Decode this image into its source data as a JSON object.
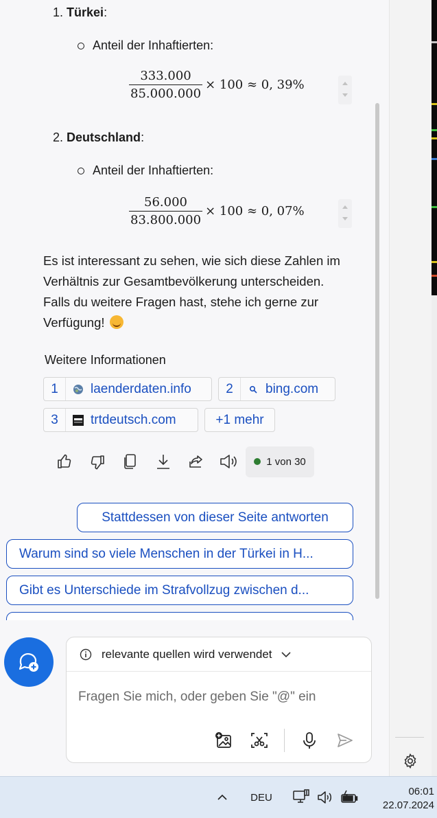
{
  "answer": {
    "item1": {
      "number": "1.",
      "country": "Türkei",
      "colon": ":"
    },
    "item1_bullet": "Anteil der Inhaftierten:",
    "formula1": {
      "numerator": "333.000",
      "denominator": "85.000.000",
      "rest": "× 100 ≈ 0, 39%"
    },
    "item2": {
      "number": "2.",
      "country": "Deutschland",
      "colon": ":"
    },
    "item2_bullet": "Anteil der Inhaftierten:",
    "formula2": {
      "numerator": "56.000",
      "denominator": "83.800.000",
      "rest": "× 100 ≈ 0, 07%"
    },
    "paragraph": "Es ist interessant zu sehen, wie sich diese Zahlen im Verhältnis zur Gesamtbevölkerung unterscheiden. Falls du weitere Fragen hast, stehe ich gerne zur Verfügung!"
  },
  "sources": {
    "heading": "Weitere Informationen",
    "items": [
      {
        "index": "1",
        "label": "laenderdaten.info",
        "icon": "globe-icon"
      },
      {
        "index": "2",
        "label": "bing.com",
        "icon": "search-icon"
      },
      {
        "index": "3",
        "label": "trtdeutsch.com",
        "icon": "trt-logo-icon"
      }
    ],
    "more": "+1 mehr"
  },
  "actions": {
    "counter": "1 von 30",
    "icons": [
      "thumbs-up-icon",
      "thumbs-down-icon",
      "copy-icon",
      "download-icon",
      "share-icon",
      "speaker-icon"
    ]
  },
  "suggestions": [
    "Stattdessen von dieser Seite antworten",
    "Warum sind so viele Menschen in der Türkei in H...",
    "Gibt es Unterschiede im Strafvollzug zwischen d..."
  ],
  "composer": {
    "status": "relevante quellen wird verwendet",
    "placeholder": "Fragen Sie mich, oder geben Sie \"@\" ein"
  },
  "taskbar": {
    "language": "DEU",
    "time": "06:01",
    "date": "22.07.2024"
  },
  "colors": {
    "accent": "#1a4fc0",
    "fab": "#1a6ee0",
    "counter_dot": "#2e7d32"
  }
}
